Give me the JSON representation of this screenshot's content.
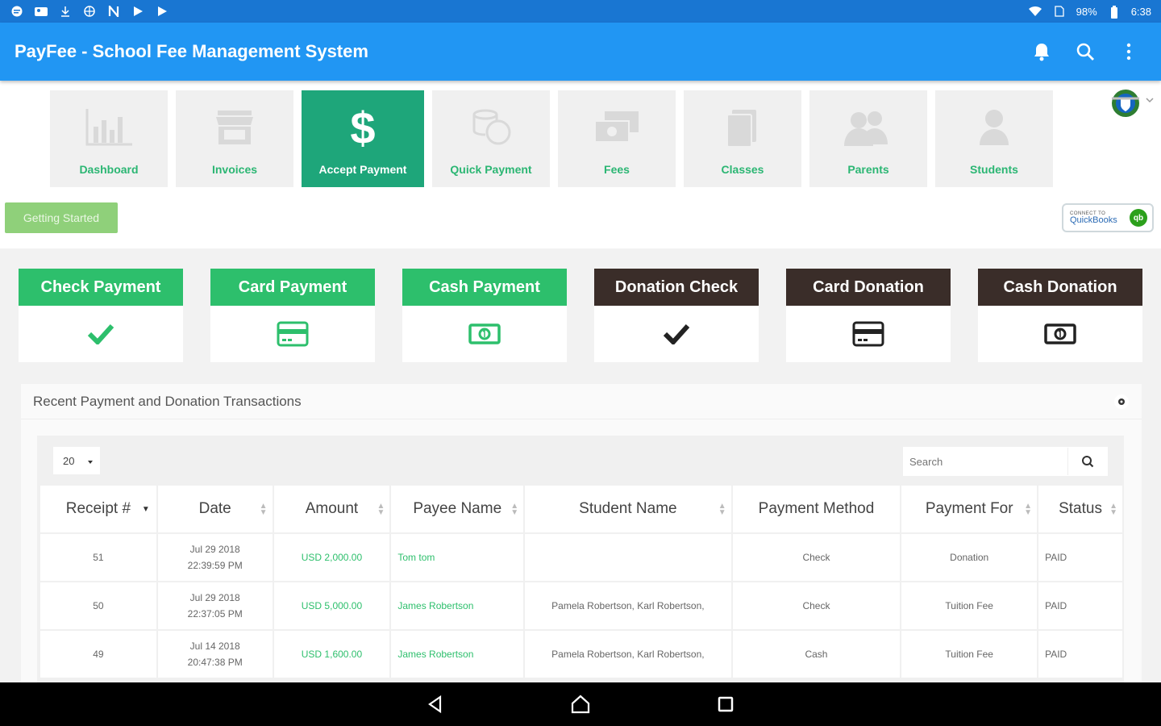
{
  "status_bar": {
    "battery": "98%",
    "time": "6:38"
  },
  "app_bar": {
    "title": "PayFee - School Fee Management System"
  },
  "nav_tiles": [
    {
      "label": "Dashboard",
      "icon": "bar-chart-icon"
    },
    {
      "label": "Invoices",
      "icon": "store-icon"
    },
    {
      "label": "Accept Payment",
      "icon": "dollar-icon",
      "active": true
    },
    {
      "label": "Quick Payment",
      "icon": "coins-icon"
    },
    {
      "label": "Fees",
      "icon": "money-stack-icon"
    },
    {
      "label": "Classes",
      "icon": "book-icon"
    },
    {
      "label": "Parents",
      "icon": "users-icon"
    },
    {
      "label": "Students",
      "icon": "user-icon"
    }
  ],
  "getting_started_label": "Getting Started",
  "quickbooks": {
    "small": "CONNECT TO",
    "big": "QuickBooks",
    "logo": "qb"
  },
  "payment_cards": [
    {
      "label": "Check Payment",
      "icon": "check-icon",
      "style": "green"
    },
    {
      "label": "Card Payment",
      "icon": "credit-card-icon",
      "style": "green"
    },
    {
      "label": "Cash Payment",
      "icon": "cash-icon",
      "style": "green"
    },
    {
      "label": "Donation Check",
      "icon": "check-icon",
      "style": "dark"
    },
    {
      "label": "Card Donation",
      "icon": "credit-card-icon",
      "style": "dark"
    },
    {
      "label": "Cash Donation",
      "icon": "cash-icon",
      "style": "dark"
    }
  ],
  "colors": {
    "primary": "#2196f3",
    "status_bar": "#1976d2",
    "accent_green": "#2dbf6c",
    "active_tile": "#1ea67a",
    "dark_card": "#3a2d29"
  },
  "transactions": {
    "title": "Recent Payment and Donation Transactions",
    "page_size": "20",
    "search_placeholder": "Search",
    "columns": [
      "Receipt #",
      "Date",
      "Amount",
      "Payee Name",
      "Student Name",
      "Payment Method",
      "Payment For",
      "Status"
    ],
    "rows": [
      {
        "receipt": "51",
        "date": "Jul 29 2018",
        "time": "22:39:59 PM",
        "amount": "USD 2,000.00",
        "payee": "Tom tom",
        "student": "",
        "method": "Check",
        "for": "Donation",
        "status": "PAID"
      },
      {
        "receipt": "50",
        "date": "Jul 29 2018",
        "time": "22:37:05 PM",
        "amount": "USD 5,000.00",
        "payee": "James Robertson",
        "student": "Pamela Robertson, Karl Robertson,",
        "method": "Check",
        "for": "Tuition Fee",
        "status": "PAID"
      },
      {
        "receipt": "49",
        "date": "Jul 14 2018",
        "time": "20:47:38 PM",
        "amount": "USD 1,600.00",
        "payee": "James Robertson",
        "student": "Pamela Robertson, Karl Robertson,",
        "method": "Cash",
        "for": "Tuition Fee",
        "status": "PAID"
      }
    ]
  }
}
